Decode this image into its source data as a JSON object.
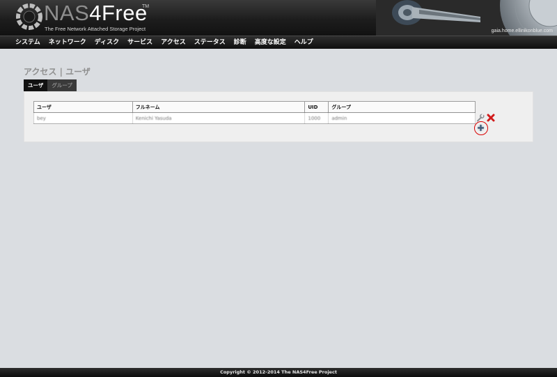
{
  "header": {
    "logo_nas": "NAS",
    "logo_4free": "4Free",
    "logo_tm": "TM",
    "tagline": "The Free Network Attached Storage Project",
    "hostname": "gaia.home.ellinikonblue.com"
  },
  "nav": {
    "items": [
      {
        "label": "システム"
      },
      {
        "label": "ネットワーク"
      },
      {
        "label": "ディスク"
      },
      {
        "label": "サービス"
      },
      {
        "label": "アクセス"
      },
      {
        "label": "ステータス"
      },
      {
        "label": "診断"
      },
      {
        "label": "高度な設定"
      },
      {
        "label": "ヘルプ"
      }
    ]
  },
  "page": {
    "title": "アクセス | ユーザ",
    "tabs": [
      {
        "label": "ユーザ",
        "active": true
      },
      {
        "label": "グループ",
        "active": false
      }
    ]
  },
  "users_table": {
    "columns": [
      "ユーザ",
      "フルネーム",
      "UID",
      "グループ"
    ],
    "rows": [
      {
        "user": "bey",
        "fullname": "Kenichi Yasuda",
        "uid": "1000",
        "group": "admin"
      }
    ]
  },
  "icons": {
    "edit": "wrench-icon",
    "delete": "red-x-icon",
    "add": "plus-icon"
  },
  "colors": {
    "background": "#dadde1",
    "header": "#1d1d1d",
    "panel": "#efefef",
    "add_highlight": "#d80000"
  },
  "footer": {
    "copyright": "Copyright © 2012-2014 The NAS4Free Project"
  }
}
